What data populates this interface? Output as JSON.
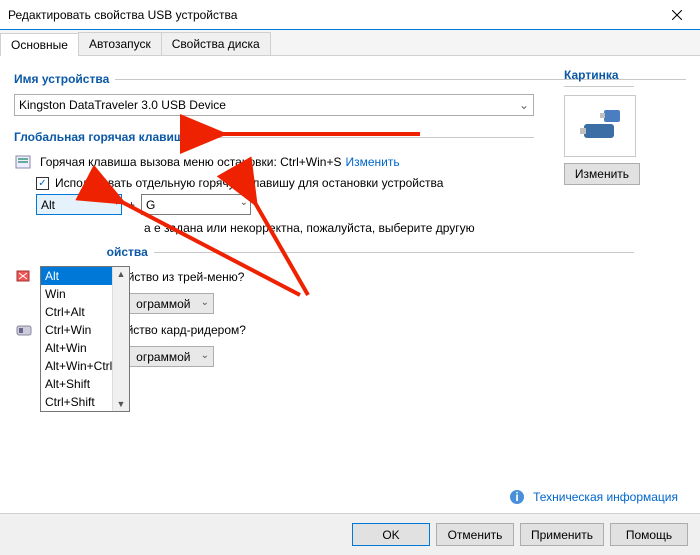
{
  "window": {
    "title": "Редактировать свойства USB устройства"
  },
  "tabs": {
    "main": "Основные",
    "autorun": "Автозапуск",
    "disk": "Свойства диска"
  },
  "sections": {
    "deviceName": "Имя устройства",
    "globalHotkey": "Глобальная горячая клавиша",
    "deviceProps": "ойства"
  },
  "deviceName": {
    "value": "Kingston DataTraveler 3.0 USB Device"
  },
  "hotkey": {
    "menuText": "Горячая клавиша вызова меню остановки: Ctrl+Win+S",
    "changeLink": "Изменить",
    "useOwnHotkey": "Использовать отдельную горячую клавишу для остановки устройства",
    "modifier": "Alt",
    "plus": "+",
    "key": "G",
    "error": "а е задана или некорректна, пожалуйста, выберите другую",
    "options": [
      "Alt",
      "Win",
      "Ctrl+Alt",
      "Ctrl+Win",
      "Alt+Win",
      "Alt+Win+Ctrl",
      "Alt+Shift",
      "Ctrl+Shift"
    ]
  },
  "tray": {
    "hideQuestion": "ройство из трей-меню?",
    "cardReaderQuestion": "стройство кард-ридером?",
    "managedByProgram": "ограммой"
  },
  "picture": {
    "label": "Картинка",
    "button": "Изменить"
  },
  "footer": {
    "techInfo": "Техническая информация",
    "ok": "OK",
    "cancel": "Отменить",
    "apply": "Применить",
    "help": "Помощь"
  },
  "annot": {
    "tailVisible": false
  }
}
